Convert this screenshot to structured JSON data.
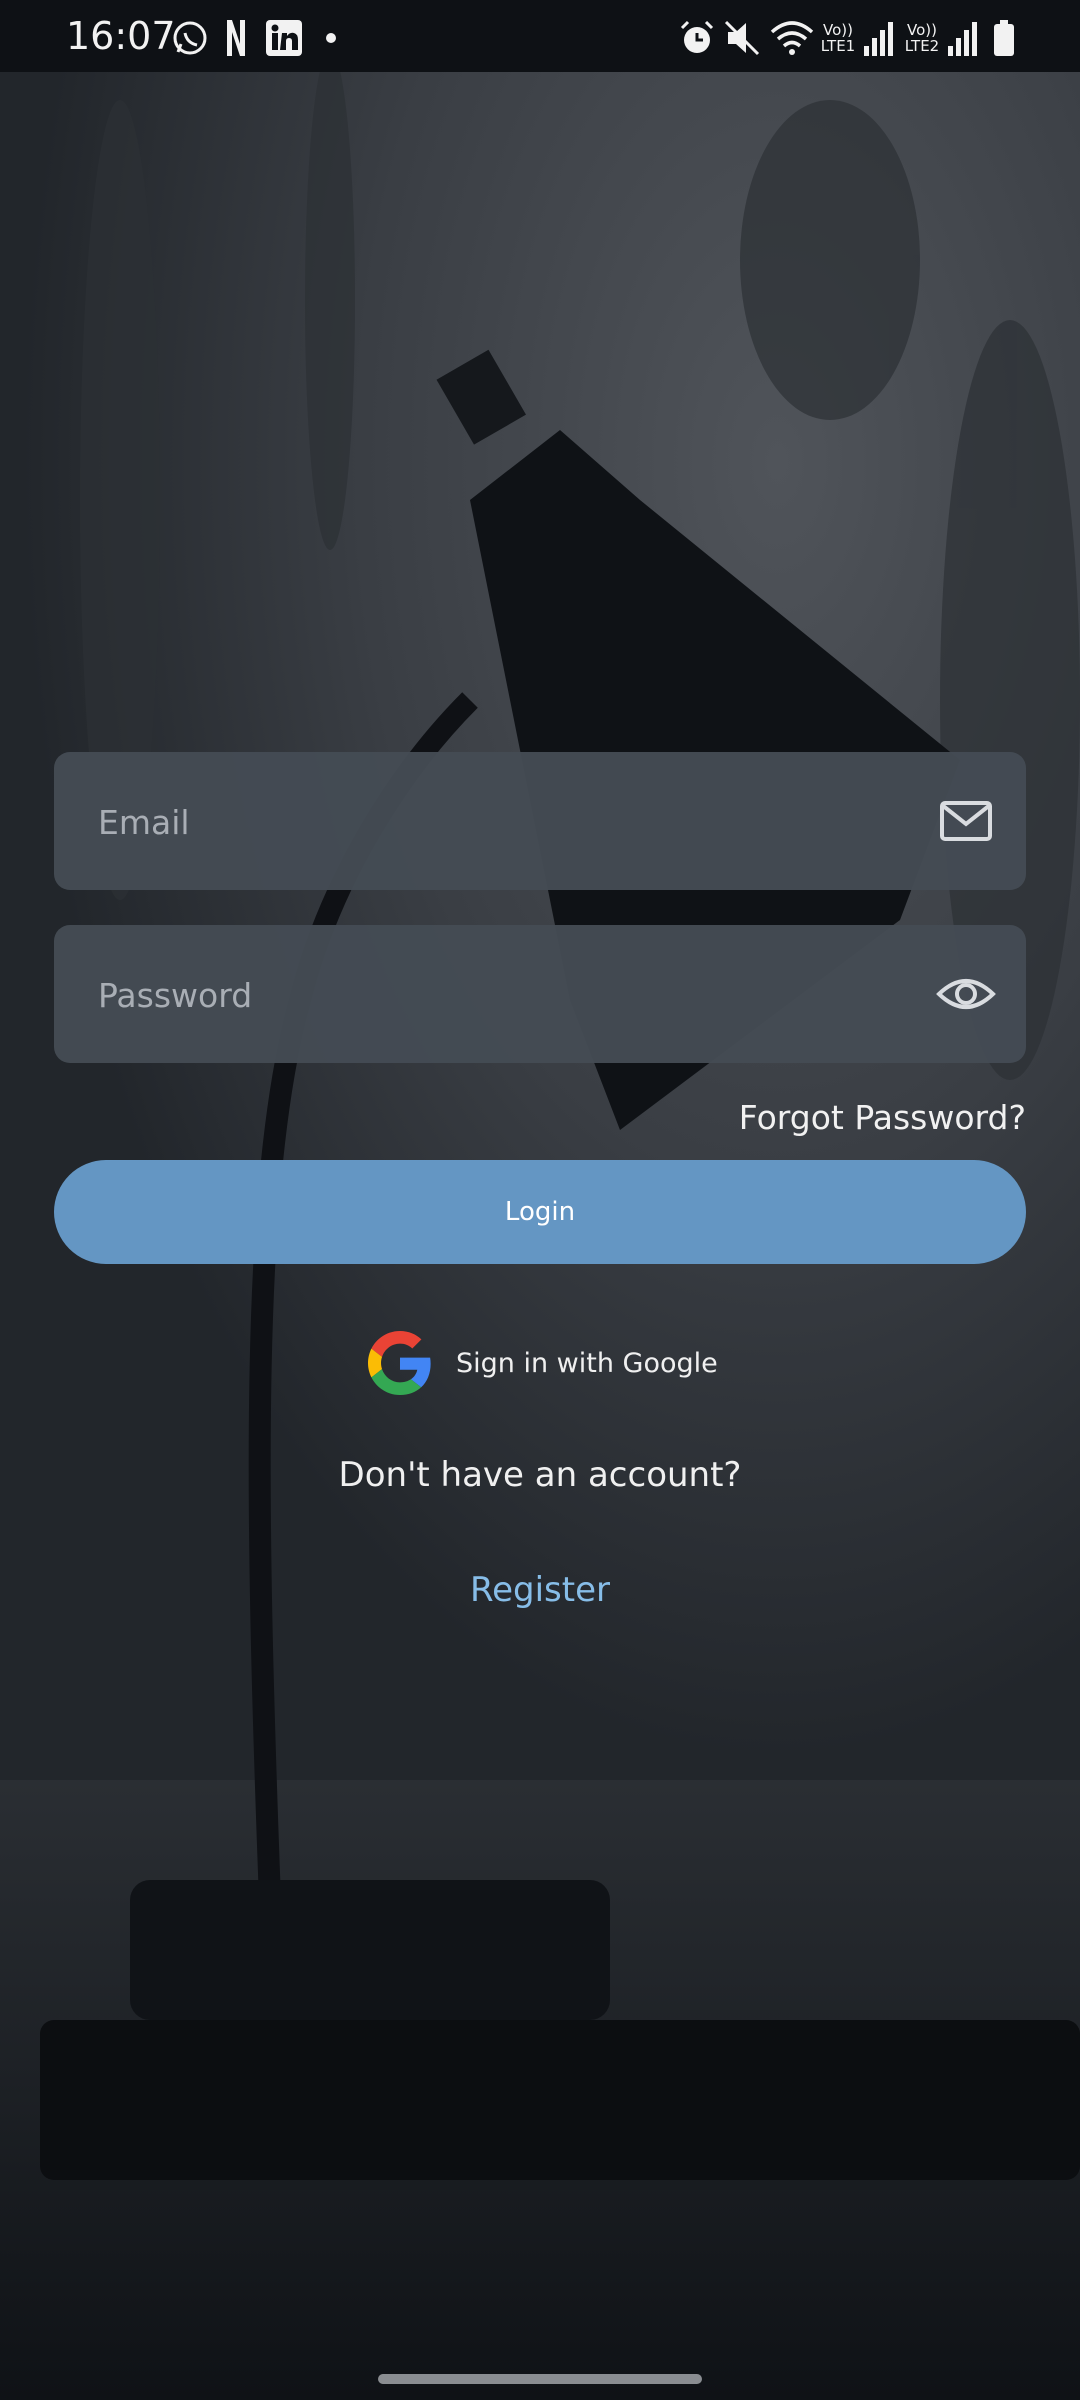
{
  "status_bar": {
    "time": "16:07",
    "notification_icons": [
      "whatsapp-icon",
      "netflix-icon",
      "linkedin-icon",
      "dot-icon"
    ],
    "system_icons": [
      "alarm-icon",
      "mute-icon",
      "wifi-icon",
      "signal-lte1-icon",
      "signal-lte2-icon",
      "battery-icon"
    ],
    "sim1_label_top": "Vo))",
    "sim1_label_bottom": "LTE1",
    "sim2_label_top": "Vo))",
    "sim2_label_bottom": "LTE2"
  },
  "form": {
    "email": {
      "placeholder": "Email",
      "value": "",
      "icon": "mail-icon"
    },
    "password": {
      "placeholder": "Password",
      "value": "",
      "icon": "eye-icon"
    },
    "forgot_label": "Forgot Password?",
    "login_label": "Login"
  },
  "google": {
    "label": "Sign in with Google",
    "icon": "google-logo-icon"
  },
  "signup": {
    "prompt": "Don't have an account?",
    "register_label": "Register"
  },
  "colors": {
    "accent_button": "#6496c3",
    "link": "#87bde8",
    "field_bg": "#444b54"
  }
}
